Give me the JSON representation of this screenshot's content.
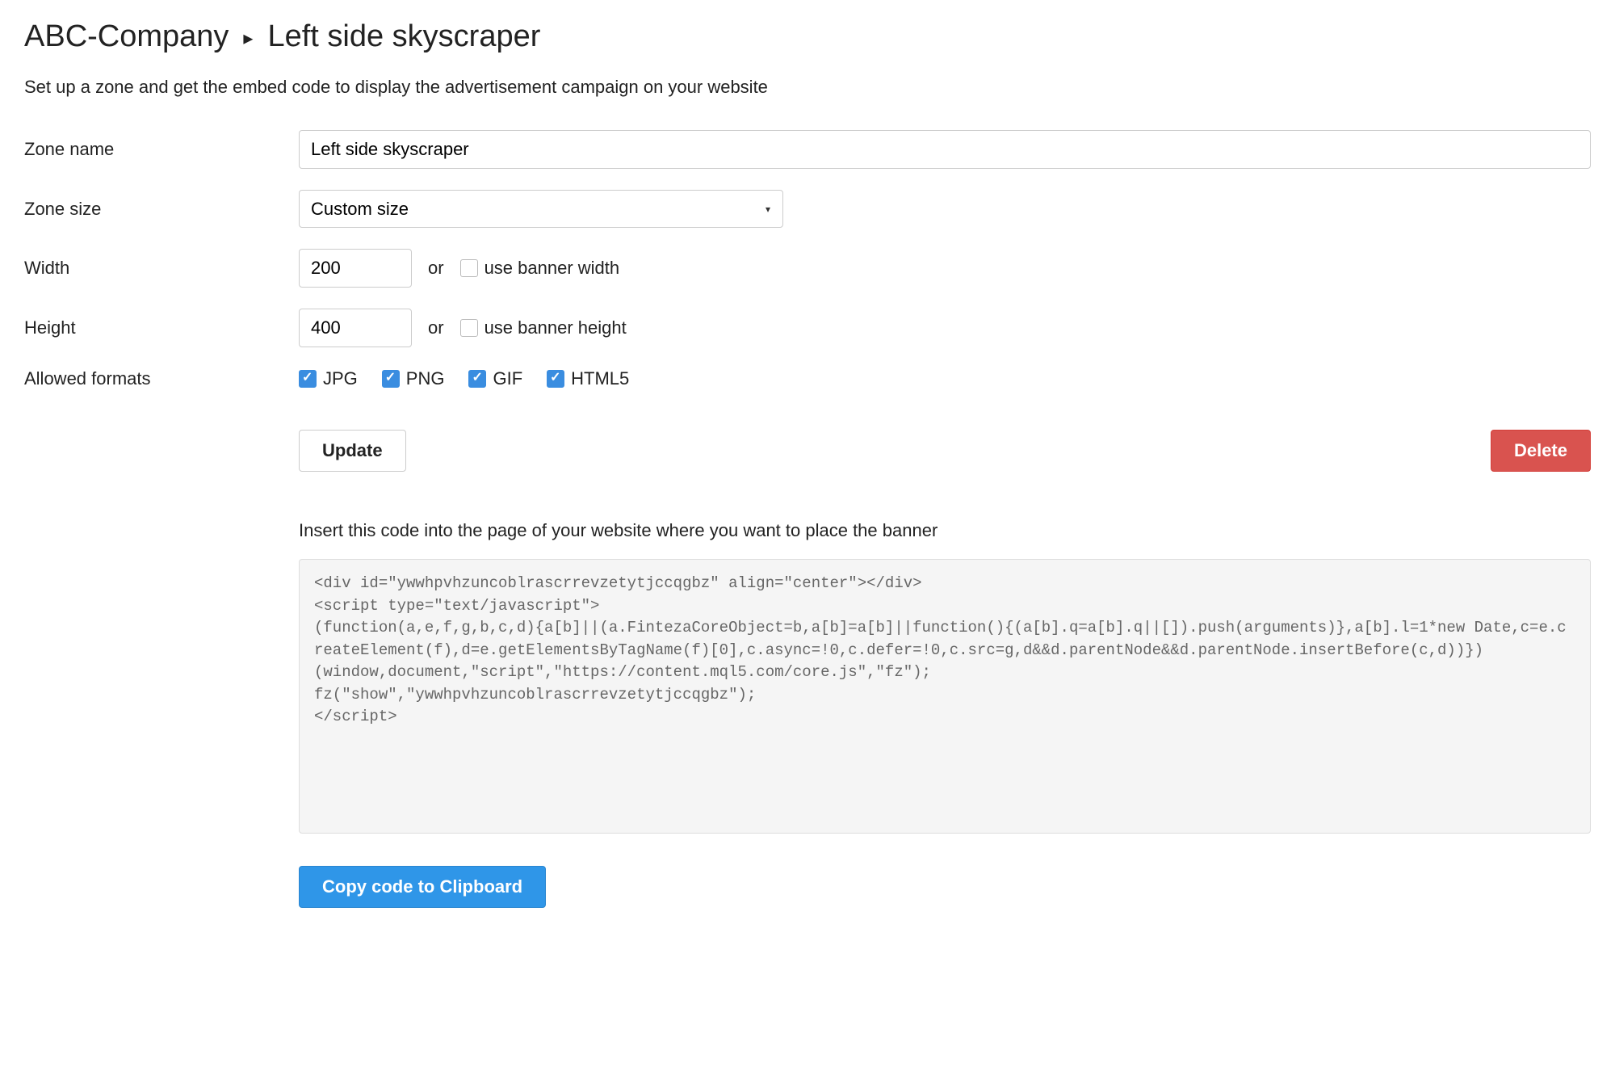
{
  "breadcrumb": {
    "parent": "ABC-Company",
    "current": "Left side skyscraper"
  },
  "subtitle": "Set up a zone and get the embed code to display the advertisement campaign on your website",
  "form": {
    "zone_name_label": "Zone name",
    "zone_name_value": "Left side skyscraper",
    "zone_size_label": "Zone size",
    "zone_size_value": "Custom size",
    "width_label": "Width",
    "width_value": "200",
    "width_or": "or",
    "width_checkbox_label": "use banner width",
    "height_label": "Height",
    "height_value": "400",
    "height_or": "or",
    "height_checkbox_label": "use banner height",
    "formats_label": "Allowed formats",
    "formats": {
      "jpg": "JPG",
      "png": "PNG",
      "gif": "GIF",
      "html5": "HTML5"
    }
  },
  "buttons": {
    "update": "Update",
    "delete": "Delete",
    "copy": "Copy code to Clipboard"
  },
  "code": {
    "instruction": "Insert this code into the page of your website where you want to place the banner",
    "snippet": "<div id=\"ywwhpvhzuncoblrascrrevzetytjccqgbz\" align=\"center\"></div>\n<script type=\"text/javascript\">\n(function(a,e,f,g,b,c,d){a[b]||(a.FintezaCoreObject=b,a[b]=a[b]||function(){(a[b].q=a[b].q||[]).push(arguments)},a[b].l=1*new Date,c=e.createElement(f),d=e.getElementsByTagName(f)[0],c.async=!0,c.defer=!0,c.src=g,d&&d.parentNode&&d.parentNode.insertBefore(c,d))})\n(window,document,\"script\",\"https://content.mql5.com/core.js\",\"fz\");\nfz(\"show\",\"ywwhpvhzuncoblrascrrevzetytjccqgbz\");\n</script>"
  }
}
